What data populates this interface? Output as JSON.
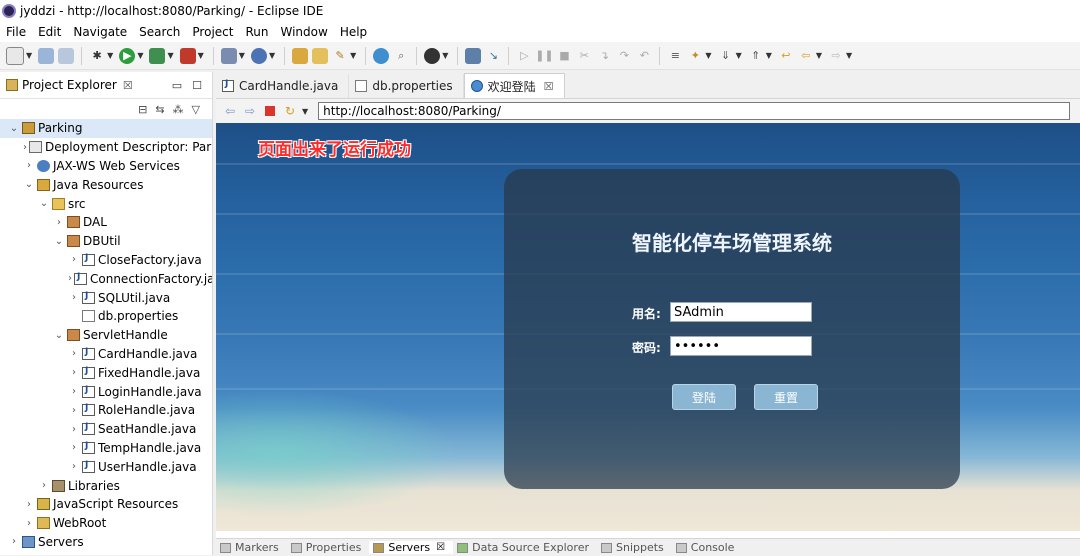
{
  "window": {
    "title": "jyddzi - http://localhost:8080/Parking/ - Eclipse IDE"
  },
  "menu": [
    "File",
    "Edit",
    "Navigate",
    "Search",
    "Project",
    "Run",
    "Window",
    "Help"
  ],
  "explorer": {
    "tab_label": "Project Explorer",
    "tree": [
      {
        "label": "Parking",
        "level": 0,
        "expanded": true,
        "icon": "project-icon",
        "selected": true
      },
      {
        "label": "Deployment Descriptor: Park",
        "level": 1,
        "expanded": false,
        "icon": "descriptor-icon"
      },
      {
        "label": "JAX-WS Web Services",
        "level": 1,
        "expanded": false,
        "icon": "web-service-icon"
      },
      {
        "label": "Java Resources",
        "level": 1,
        "expanded": true,
        "icon": "java-resources-icon"
      },
      {
        "label": "src",
        "level": 2,
        "expanded": true,
        "icon": "source-folder-icon"
      },
      {
        "label": "DAL",
        "level": 3,
        "expanded": false,
        "icon": "package-icon"
      },
      {
        "label": "DBUtil",
        "level": 3,
        "expanded": true,
        "icon": "package-icon"
      },
      {
        "label": "CloseFactory.java",
        "level": 4,
        "expanded": false,
        "icon": "java-file-icon"
      },
      {
        "label": "ConnectionFactory.ja",
        "level": 4,
        "expanded": false,
        "icon": "java-file-icon"
      },
      {
        "label": "SQLUtil.java",
        "level": 4,
        "expanded": false,
        "icon": "java-file-icon"
      },
      {
        "label": "db.properties",
        "level": 4,
        "expanded": null,
        "icon": "properties-file-icon"
      },
      {
        "label": "ServletHandle",
        "level": 3,
        "expanded": true,
        "icon": "package-icon"
      },
      {
        "label": "CardHandle.java",
        "level": 4,
        "expanded": false,
        "icon": "java-file-icon"
      },
      {
        "label": "FixedHandle.java",
        "level": 4,
        "expanded": false,
        "icon": "java-file-icon"
      },
      {
        "label": "LoginHandle.java",
        "level": 4,
        "expanded": false,
        "icon": "java-file-icon"
      },
      {
        "label": "RoleHandle.java",
        "level": 4,
        "expanded": false,
        "icon": "java-file-icon"
      },
      {
        "label": "SeatHandle.java",
        "level": 4,
        "expanded": false,
        "icon": "java-file-icon"
      },
      {
        "label": "TempHandle.java",
        "level": 4,
        "expanded": false,
        "icon": "java-file-icon"
      },
      {
        "label": "UserHandle.java",
        "level": 4,
        "expanded": false,
        "icon": "java-file-icon"
      },
      {
        "label": "Libraries",
        "level": 2,
        "expanded": false,
        "icon": "library-icon"
      },
      {
        "label": "JavaScript Resources",
        "level": 1,
        "expanded": false,
        "icon": "javascript-resources-icon"
      },
      {
        "label": "WebRoot",
        "level": 1,
        "expanded": false,
        "icon": "webroot-folder-icon"
      },
      {
        "label": "Servers",
        "level": 0,
        "expanded": false,
        "icon": "servers-project-icon"
      }
    ]
  },
  "editor": {
    "tabs": [
      {
        "label": "CardHandle.java",
        "icon": "java-file-icon",
        "active": false
      },
      {
        "label": "db.properties",
        "icon": "properties-file-icon",
        "active": false
      },
      {
        "label": "欢迎登陆",
        "icon": "globe-icon",
        "active": true
      }
    ],
    "url": "http://localhost:8080/Parking/"
  },
  "page": {
    "annotation": "页面出来了运行成功",
    "title": "智能化停车场管理系统",
    "username_label": "用名:",
    "username_value": "SAdmin",
    "password_label": "密码:",
    "password_value": "••••••",
    "login_button": "登陆",
    "reset_button": "重置"
  },
  "bottom_tabs": [
    {
      "label": "Markers",
      "active": false
    },
    {
      "label": "Properties",
      "active": false
    },
    {
      "label": "Servers",
      "active": true
    },
    {
      "label": "Data Source Explorer",
      "active": false
    },
    {
      "label": "Snippets",
      "active": false
    },
    {
      "label": "Console",
      "active": false
    }
  ],
  "colors": {
    "annotation": "#ff2a2a",
    "panel": "#283748",
    "button": "#8bb6d3"
  }
}
